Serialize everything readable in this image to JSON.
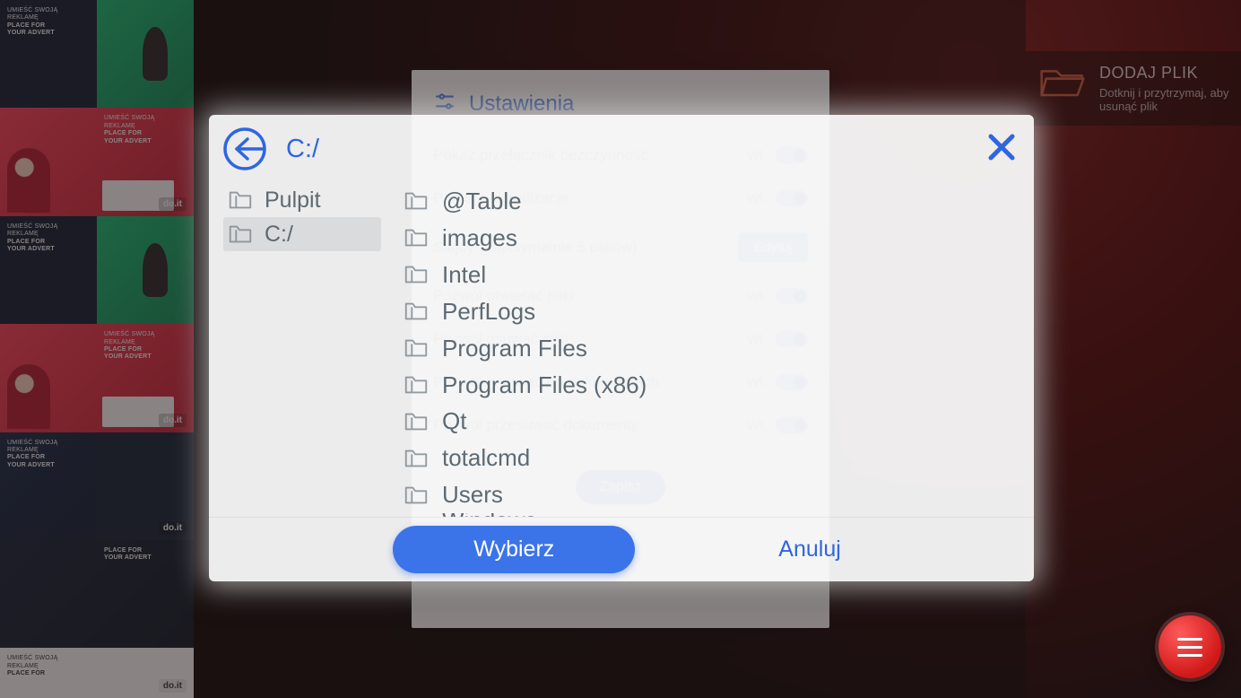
{
  "addFile": {
    "title": "DODAJ PLIK",
    "subtitle": "Dotknij i przytrzymaj, aby usunąć plik"
  },
  "thumbs": {
    "head_pl": "UMIEŚĆ SWOJĄ REKLAMĘ",
    "head_en": "PLACE FOR",
    "head_en2": "YOUR ADVERT",
    "tag": "do.it"
  },
  "settings": {
    "title": "Ustawienia",
    "rows": [
      {
        "label": "Pokaż przełącznik bezczynność",
        "state": "Wł."
      },
      {
        "label": "Pobierz aktualizacje",
        "state": "Wł."
      },
      {
        "label": "Slajdy (maksymalnie 5 plików)",
        "state": "Edytuj",
        "type": "button"
      },
      {
        "label": "Pozwól otwierać pliki",
        "state": "Wł."
      },
      {
        "label": "Pozwól usuwać pliki",
        "state": "Wł."
      },
      {
        "label": "Pozwól rysować po dokumentach",
        "state": "Wł."
      },
      {
        "label": "Pozwól przesuwać dokumenty",
        "state": "Wł."
      }
    ],
    "save": "Zapisz"
  },
  "dialog": {
    "path": "C:/",
    "places": [
      {
        "label": "Pulpit",
        "selected": false
      },
      {
        "label": "C:/",
        "selected": true
      }
    ],
    "folders": [
      "@Table",
      "images",
      "Intel",
      "PerfLogs",
      "Program Files",
      "Program Files (x86)",
      "Qt",
      "totalcmd",
      "Users",
      "Windows"
    ],
    "select": "Wybierz",
    "cancel": "Anuluj"
  }
}
